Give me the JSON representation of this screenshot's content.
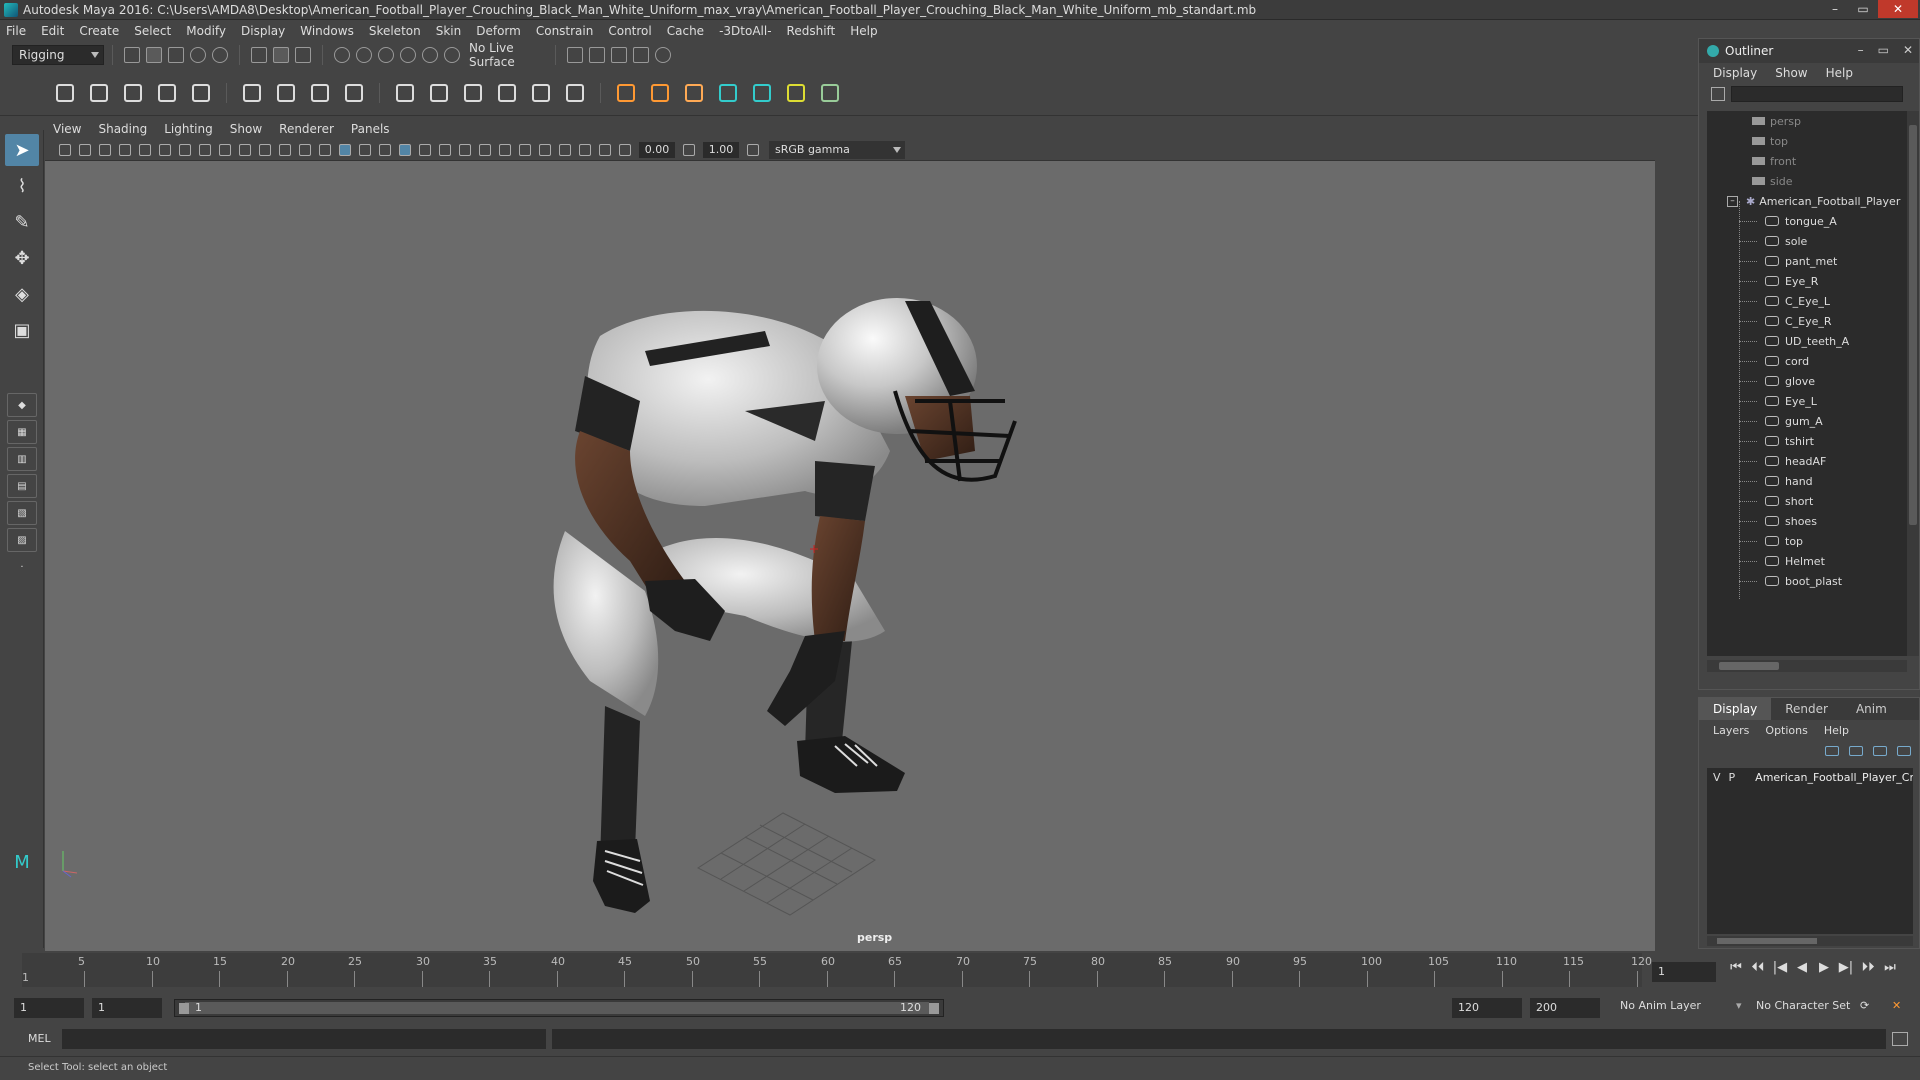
{
  "window": {
    "title": "Autodesk Maya 2016: C:\\Users\\AMDA8\\Desktop\\American_Football_Player_Crouching_Black_Man_White_Uniform_max_vray\\American_Football_Player_Crouching_Black_Man_White_Uniform_mb_standart.mb",
    "minimize": "–",
    "maximize": "▭",
    "close": "✕"
  },
  "menubar": [
    "File",
    "Edit",
    "Create",
    "Select",
    "Modify",
    "Display",
    "Windows",
    "Skeleton",
    "Skin",
    "Deform",
    "Constrain",
    "Control",
    "Cache",
    "-3DtoAll-",
    "Redshift",
    "Help"
  ],
  "statusline": {
    "mode": "Rigging",
    "live_surface": "No Live Surface"
  },
  "viewport": {
    "menu": [
      "View",
      "Shading",
      "Lighting",
      "Show",
      "Renderer",
      "Panels"
    ],
    "exposure": "0.00",
    "gamma": "1.00",
    "colorspace": "sRGB gamma",
    "camera_label": "persp"
  },
  "outliner": {
    "title": "Outliner",
    "menu": [
      "Display",
      "Show",
      "Help"
    ],
    "cameras": [
      "persp",
      "top",
      "front",
      "side"
    ],
    "group": "American_Football_Player",
    "children": [
      "tongue_A",
      "sole",
      "pant_met",
      "Eye_R",
      "C_Eye_L",
      "C_Eye_R",
      "UD_teeth_A",
      "cord",
      "glove",
      "Eye_L",
      "gum_A",
      "tshirt",
      "headAF",
      "hand",
      "short",
      "shoes",
      "top",
      "Helmet",
      "boot_plast"
    ]
  },
  "layers": {
    "tabs": [
      "Display",
      "Render",
      "Anim"
    ],
    "menu": [
      "Layers",
      "Options",
      "Help"
    ],
    "v": "V",
    "p": "P",
    "layer_name": "American_Football_Player_Cr",
    "layer_color": "#b01e2e"
  },
  "timeline": {
    "ticks": [
      "5",
      "10",
      "15",
      "20",
      "25",
      "30",
      "35",
      "40",
      "45",
      "50",
      "55",
      "60",
      "65",
      "70",
      "75",
      "80",
      "85",
      "90",
      "95",
      "100",
      "105",
      "110",
      "115",
      "120"
    ],
    "first": "1",
    "current_frame": "1",
    "playback": [
      "⏮",
      "⏴⏴",
      "|◀",
      "◀",
      "▶",
      "▶|",
      "⏵⏵",
      "⏭"
    ]
  },
  "range": {
    "start": "1",
    "start2": "1",
    "bar_start": "1",
    "bar_end": "120",
    "end": "120",
    "end2": "200",
    "anim_layer": "No Anim Layer",
    "character_set": "No Character Set"
  },
  "cmdline": {
    "label": "MEL"
  },
  "helpline": {
    "text": "Select Tool: select an object"
  }
}
